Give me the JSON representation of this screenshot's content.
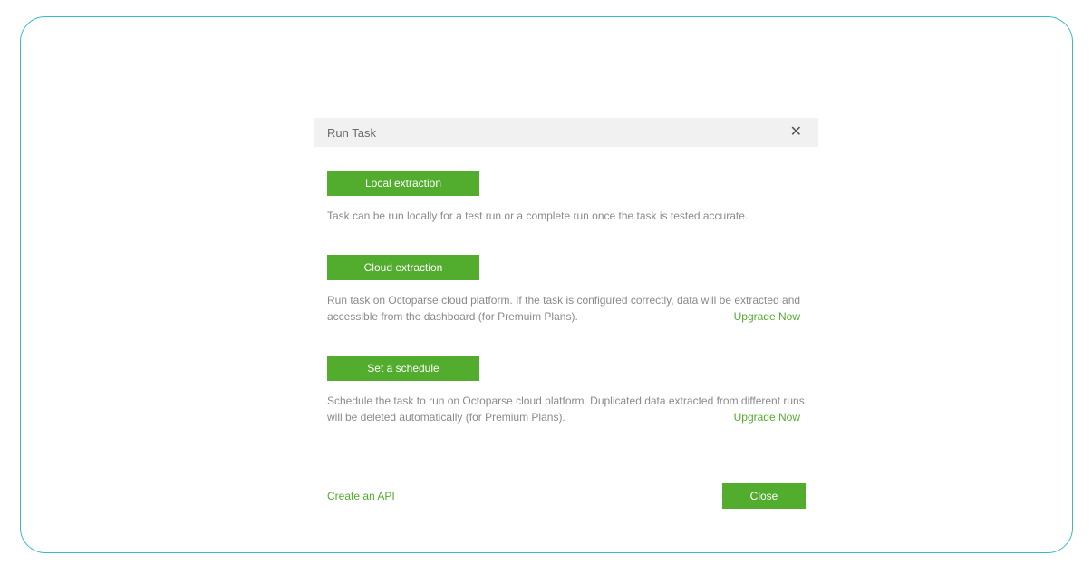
{
  "modal": {
    "title": "Run Task",
    "close_icon": "✕",
    "sections": {
      "local": {
        "button": "Local extraction",
        "desc": "Task can be run locally for a test run or a complete run once the task is tested accurate."
      },
      "cloud": {
        "button": "Cloud extraction",
        "desc": "Run task on Octoparse cloud platform. If the task is configured correctly, data will be extracted and accessible from the dashboard (for Premuim Plans).",
        "upgrade": "Upgrade Now"
      },
      "schedule": {
        "button": "Set a schedule",
        "desc": "Schedule the task to run on Octoparse cloud platform. Duplicated data extracted from different runs will be deleted automatically (for Premium Plans).",
        "upgrade": "Upgrade Now"
      }
    },
    "footer": {
      "api_link": "Create an API",
      "close_button": "Close"
    }
  }
}
